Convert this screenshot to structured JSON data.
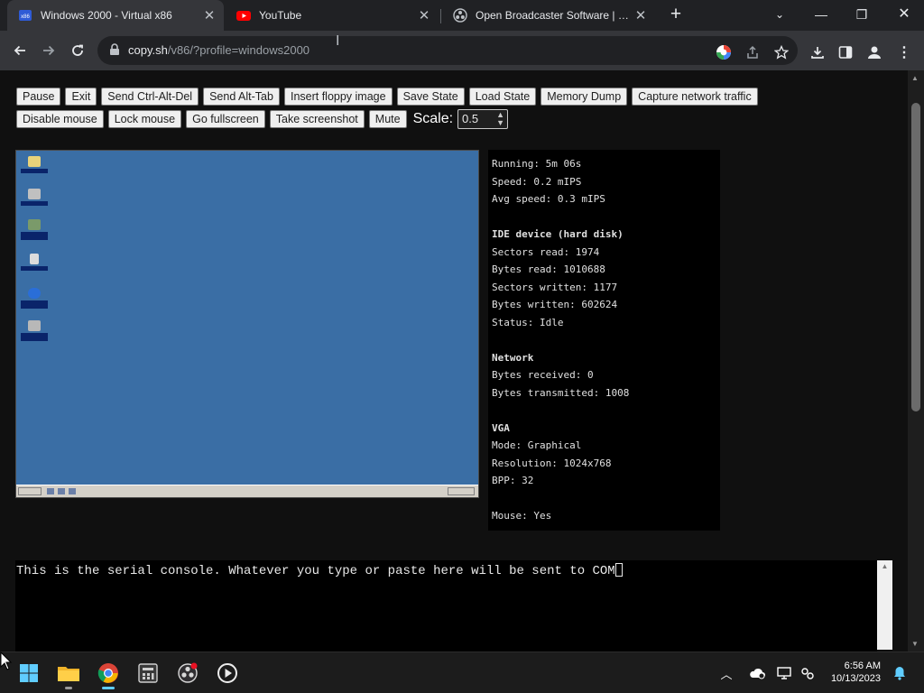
{
  "browser": {
    "tabs": [
      {
        "title": "Windows 2000 - Virtual x86",
        "active": true,
        "close_icon": "close-icon"
      },
      {
        "title": "YouTube",
        "active": false,
        "close_icon": "close-icon"
      },
      {
        "title": "Open Broadcaster Software | OB",
        "active": false,
        "close_icon": "close-icon"
      }
    ],
    "url_host": "copy.sh",
    "url_path": "/v86/?profile=windows2000"
  },
  "controls": {
    "row1": [
      "Pause",
      "Exit",
      "Send Ctrl-Alt-Del",
      "Send Alt-Tab",
      "Insert floppy image",
      "Save State",
      "Load State",
      "Memory Dump",
      "Capture network traffic"
    ],
    "row2": [
      "Disable mouse",
      "Lock mouse",
      "Go fullscreen",
      "Take screenshot",
      "Mute"
    ],
    "scale_label": "Scale:",
    "scale_value": "0.5"
  },
  "stats": {
    "running": "Running: 5m 06s",
    "speed": "Speed: 0.2 mIPS",
    "avg_speed": "Avg speed: 0.3 mIPS",
    "ide_header": "IDE device (hard disk)",
    "sectors_read": "Sectors read: 1974",
    "bytes_read": "Bytes read: 1010688",
    "sectors_written": "Sectors written: 1177",
    "bytes_written": "Bytes written: 602624",
    "status": "Status: Idle",
    "network_header": "Network",
    "bytes_received": "Bytes received: 0",
    "bytes_transmitted": "Bytes transmitted: 1008",
    "vga_header": "VGA",
    "mode": "Mode: Graphical",
    "resolution": "Resolution: 1024x768",
    "bpp": "BPP: 32",
    "mouse": "Mouse: Yes"
  },
  "serial_console": {
    "text": "This is the serial console. Whatever you type or paste here will be sent to COM"
  },
  "taskbar": {
    "time": "6:56 AM",
    "date": "10/13/2023"
  },
  "colors": {
    "desktop": "#3a6ea5",
    "accent": "#60cdff",
    "youtube": "#ff0000"
  }
}
